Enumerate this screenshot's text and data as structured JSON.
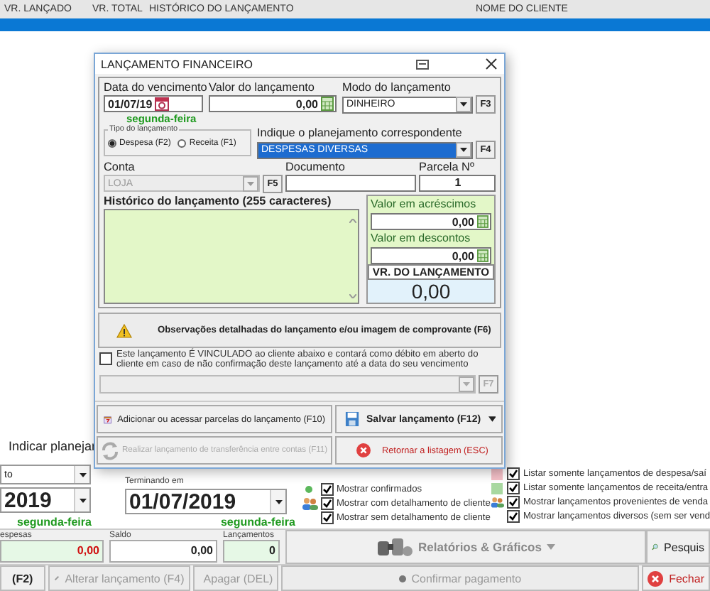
{
  "list": {
    "columns": [
      "VR. LANÇADO",
      "VR. TOTAL",
      "HISTÓRICO DO LANÇAMENTO",
      "NOME DO CLIENTE"
    ],
    "rows": [
      {
        "selected": true
      }
    ]
  },
  "panel": {
    "plan_button": "Indicar planejar",
    "type_combo": "to",
    "start_date": "2019",
    "start_weekday": "segunda-feira",
    "end_label": "Terminando em",
    "end_date": "01/07/2019",
    "end_weekday": "segunda-feira",
    "show_options": [
      {
        "label": "Mostrar confirmados",
        "checked": true,
        "kind": "dot"
      },
      {
        "label": "Mostrar com detalhamento de cliente",
        "checked": true,
        "kind": "people"
      },
      {
        "label": "Mostrar sem detalhamento de cliente",
        "checked": true,
        "kind": "none"
      }
    ],
    "list_options": [
      {
        "label": "Listar somente lançamentos de despesa/saí",
        "checked": true,
        "kind": "expense"
      },
      {
        "label": "Listar somente lançamentos de receita/entra",
        "checked": true,
        "kind": "income"
      },
      {
        "label": "Mostrar lançamentos provenientes de venda",
        "checked": true,
        "kind": "people"
      },
      {
        "label": "Mostrar lançamentos diversos (sem ser vend",
        "checked": true,
        "kind": "none"
      }
    ],
    "totals": [
      {
        "label": "espesas",
        "value": "0,00",
        "kind": "negative"
      },
      {
        "label": "Saldo",
        "value": "0,00",
        "kind": "plain"
      },
      {
        "label": "Lançamentos",
        "value": "0",
        "kind": "count"
      }
    ],
    "reports_button": "Relatórios & Gráficos",
    "search_button": "Pesquis",
    "actions": [
      {
        "label": "(F2)",
        "kind": "plain",
        "disabled": false
      },
      {
        "label": "Alterar lançamento (F4)",
        "kind": "edit",
        "disabled": true
      },
      {
        "label": "Apagar (DEL)",
        "kind": "delete",
        "disabled": true
      },
      {
        "label": "Confirmar pagamento",
        "kind": "confirm",
        "disabled": true
      }
    ],
    "close_button": "Fechar"
  },
  "dialog": {
    "title": "LANÇAMENTO FINANCEIRO",
    "due_date": {
      "label": "Data do vencimento",
      "value": "01/07/19",
      "weekday": "segunda-feira"
    },
    "amount": {
      "label": "Valor do lançamento",
      "value": "0,00"
    },
    "mode": {
      "label": "Modo do lançamento",
      "value": "DINHEIRO",
      "key": "F3"
    },
    "entry_type": {
      "label": "Tipo do lançamento",
      "options": [
        {
          "label": "Despesa (F2)",
          "selected": true
        },
        {
          "label": "Receita (F1)",
          "selected": false
        }
      ]
    },
    "plan": {
      "label": "Indique o planejamento correspondente",
      "value": "DESPESAS DIVERSAS",
      "key": "F4"
    },
    "account": {
      "label": "Conta",
      "value": "LOJA",
      "key": "F5",
      "disabled": true
    },
    "document": {
      "label": "Documento"
    },
    "installment": {
      "label": "Parcela Nº",
      "value": "1"
    },
    "history": {
      "label": "Histórico do lançamento (255 caracteres)"
    },
    "additions": {
      "label": "Valor em acréscimos",
      "value": "0,00"
    },
    "discounts": {
      "label": "Valor em descontos",
      "value": "0,00"
    },
    "total": {
      "label": "VR. DO LANÇAMENTO",
      "value": "0,00"
    },
    "notes_button": "Observações detalhadas do lançamento e/ou imagem de comprovante (F6)",
    "link_client": {
      "label": "Este lançamento É VINCULADO ao cliente abaixo e contará como débito em aberto do cliente em caso de não confirmação deste lançamento até a data do seu vencimento",
      "checked": false
    },
    "client_combo": {
      "key": "F7",
      "disabled": true
    },
    "buttons": [
      {
        "label": "Adicionar ou acessar parcelas do lançamento (F10)",
        "kind": "installments",
        "disabled": false
      },
      {
        "label": "Salvar lançamento (F12)",
        "kind": "save",
        "disabled": false
      },
      {
        "label": "Realizar lançamento de transferência entre contas (F11)",
        "kind": "transfer",
        "disabled": true
      },
      {
        "label": "Retornar a listagem (ESC)",
        "kind": "cancel",
        "disabled": false
      }
    ]
  }
}
